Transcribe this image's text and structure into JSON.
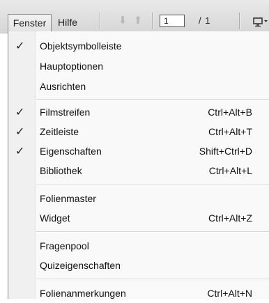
{
  "menubar": {
    "fenster_label": "Fenster",
    "hilfe_label": "Hilfe"
  },
  "toolbar": {
    "down_arrow_icon": "arrow-down-icon",
    "up_arrow_icon": "arrow-up-icon",
    "page_value": "1",
    "page_total": "/ 1",
    "screen_icon": "screen-dropdown-icon"
  },
  "menu": {
    "checkmark_glyph": "✓",
    "items": [
      {
        "label": "Objektsymbolleiste",
        "shortcut": "",
        "checked": true
      },
      {
        "label": "Hauptoptionen",
        "shortcut": "",
        "checked": false
      },
      {
        "label": "Ausrichten",
        "shortcut": "",
        "checked": false
      },
      {
        "label": "Filmstreifen",
        "shortcut": "Ctrl+Alt+B",
        "checked": true
      },
      {
        "label": "Zeitleiste",
        "shortcut": "Ctrl+Alt+T",
        "checked": true
      },
      {
        "label": "Eigenschaften",
        "shortcut": "Shift+Ctrl+D",
        "checked": true
      },
      {
        "label": "Bibliothek",
        "shortcut": "Ctrl+Alt+L",
        "checked": false
      },
      {
        "label": "Folienmaster",
        "shortcut": "",
        "checked": false
      },
      {
        "label": "Widget",
        "shortcut": "Ctrl+Alt+Z",
        "checked": false
      },
      {
        "label": "Fragenpool",
        "shortcut": "",
        "checked": false
      },
      {
        "label": "Quizeigenschaften",
        "shortcut": "",
        "checked": false
      },
      {
        "label": "Folienanmerkungen",
        "shortcut": "Ctrl+Alt+N",
        "checked": false
      }
    ]
  }
}
